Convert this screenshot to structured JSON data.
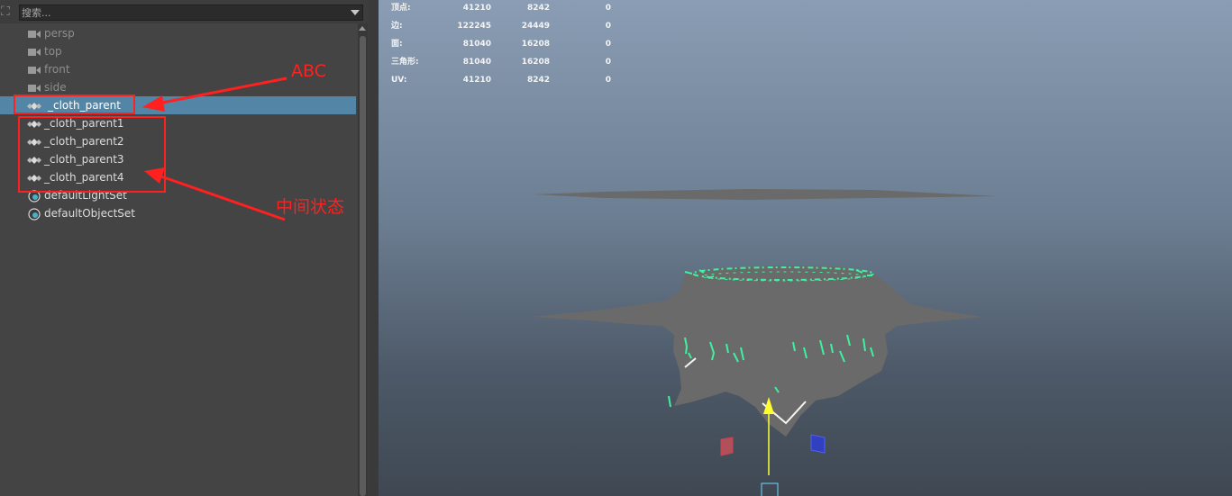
{
  "outliner": {
    "search_placeholder": "搜索...",
    "items": [
      {
        "label": "persp",
        "kind": "camera",
        "icon": "camera-icon"
      },
      {
        "label": "top",
        "kind": "camera",
        "icon": "camera-icon"
      },
      {
        "label": "front",
        "kind": "camera",
        "icon": "camera-icon"
      },
      {
        "label": "side",
        "kind": "camera",
        "icon": "camera-icon"
      },
      {
        "label": "_cloth_parent",
        "kind": "transform",
        "icon": "group-icon",
        "selected": true
      },
      {
        "label": "_cloth_parent1",
        "kind": "transform",
        "icon": "group-icon"
      },
      {
        "label": "_cloth_parent2",
        "kind": "transform",
        "icon": "group-icon"
      },
      {
        "label": "_cloth_parent3",
        "kind": "transform",
        "icon": "group-icon"
      },
      {
        "label": "_cloth_parent4",
        "kind": "transform",
        "icon": "group-icon"
      },
      {
        "label": "defaultLightSet",
        "kind": "set",
        "icon": "set-icon"
      },
      {
        "label": "defaultObjectSet",
        "kind": "set",
        "icon": "set-icon"
      }
    ]
  },
  "hud": {
    "rows": [
      {
        "label": "顶点:",
        "total": "41210",
        "selected": "8242",
        "extra": "0"
      },
      {
        "label": "边:",
        "total": "122245",
        "selected": "24449",
        "extra": "0"
      },
      {
        "label": "面:",
        "total": "81040",
        "selected": "16208",
        "extra": "0"
      },
      {
        "label": "三角形:",
        "total": "81040",
        "selected": "16208",
        "extra": "0"
      },
      {
        "label": "UV:",
        "total": "41210",
        "selected": "8242",
        "extra": "0"
      }
    ]
  },
  "annotations": {
    "abc": "ABC",
    "intermediate": "中间状态",
    "color": "#ff2020"
  },
  "colors": {
    "selection": "#5285a6",
    "mesh": "#6a6a6a",
    "highlight": "#40f0a0"
  }
}
